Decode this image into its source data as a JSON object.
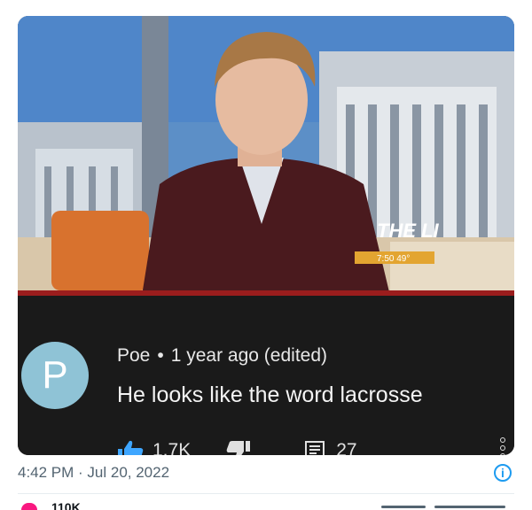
{
  "comment": {
    "avatar_letter": "P",
    "author": "Poe",
    "separator": "•",
    "time": "1 year ago (edited)",
    "text": "He looks like the word lacrosse",
    "likes": "1.7K",
    "replies": "27"
  },
  "video": {
    "station_logo": "THE LI",
    "clock": "7:50 49°"
  },
  "tweet": {
    "timestamp": "4:42 PM · Jul 20, 2022",
    "likes": "110K"
  },
  "colors": {
    "card_bg": "#1a1a1a",
    "avatar": "#8fc3d6",
    "accent_blue": "#1d9bf0",
    "heart": "#f91880"
  }
}
